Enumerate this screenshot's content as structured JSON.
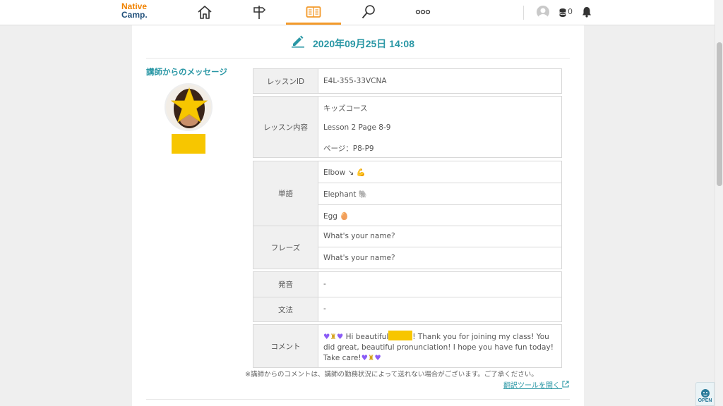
{
  "header": {
    "logo_line1": "Native",
    "logo_line2": "Camp.",
    "nav": [
      {
        "icon": "home-icon"
      },
      {
        "icon": "signpost-icon"
      },
      {
        "icon": "book-icon",
        "active": true
      },
      {
        "icon": "search-icon"
      },
      {
        "icon": "more-icon"
      }
    ],
    "coin_count": "0",
    "accent_color": "#f39a2a"
  },
  "lesson": {
    "datetime": "2020年09月25日 14:08",
    "teacher_label": "講師からのメッセージ",
    "rows": {
      "lesson_id_label": "レッスンID",
      "lesson_id_value": "E4L-355-33VCNA",
      "content_label": "レッスン内容",
      "content_values": [
        "キッズコース",
        "Lesson 2 Page 8-9",
        "ページ：P8-P9"
      ],
      "vocab_label": "単語",
      "vocab_values": [
        "Elbow ↘ 💪",
        "Elephant 🐘",
        "Egg 🥚"
      ],
      "phrase_label": "フレーズ",
      "phrase_values": [
        "What's your name?",
        "What's your name?"
      ],
      "pronunciation_label": "発音",
      "pronunciation_value": "-",
      "grammar_label": "文法",
      "grammar_value": "-",
      "comment_label": "コメント",
      "comment_part1": "Hi beautiful",
      "comment_part2": "! Thank you for joining my class! You did great, beautiful pronunciation! I hope you have fun today! Take care!"
    },
    "note": "※講師からのコメントは、講師の勤務状況によって送れない場合がございます。ご了承ください。",
    "translate_link": "翻訳ツールを開く"
  },
  "widget": {
    "open_label": "OPEN"
  }
}
